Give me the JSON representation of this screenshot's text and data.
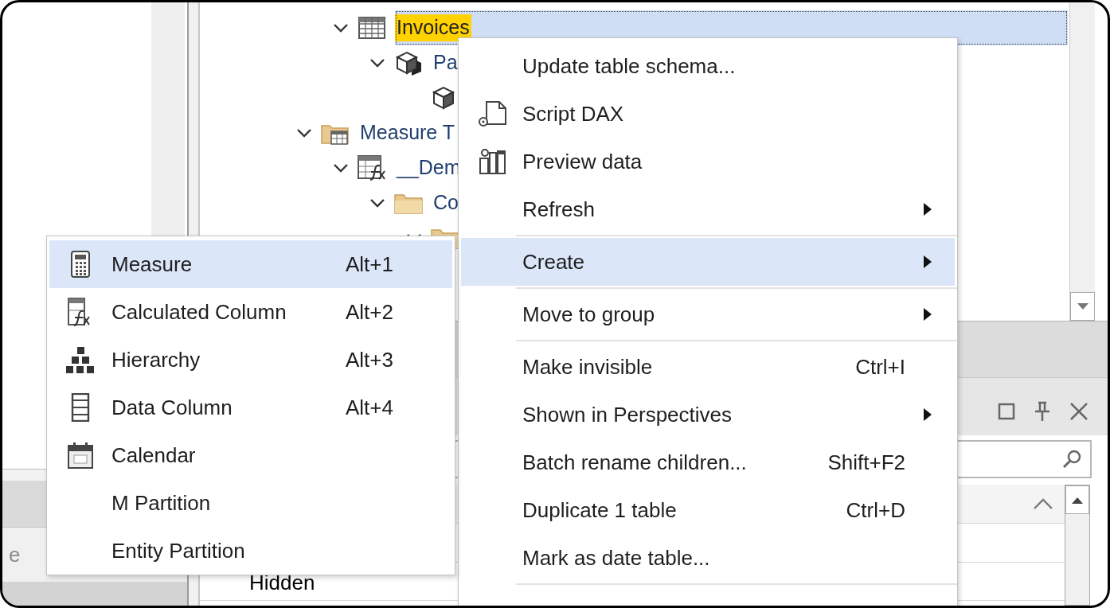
{
  "tree": {
    "items": [
      {
        "kind": "continued",
        "children": [
          {
            "kind": "table",
            "label": "Invoices",
            "expanded": true,
            "selected": true,
            "match": true,
            "children": [
              {
                "kind": "partitions",
                "label": "Pa",
                "expanded": true,
                "selected": false,
                "children": [
                  {
                    "kind": "partition",
                    "selected": false
                  }
                ]
              }
            ]
          }
        ]
      },
      {
        "kind": "measure-table",
        "label": "Measure T",
        "expanded": true,
        "selected": false,
        "children": [
          {
            "kind": "calc-table",
            "label": "__Dem",
            "expanded": true,
            "selected": false,
            "children": [
              {
                "kind": "folder",
                "label": "Co",
                "expanded": true,
                "selected": false,
                "children": [
                  {
                    "kind": "folder",
                    "expanded": true,
                    "selected": false
                  }
                ]
              }
            ]
          }
        ]
      }
    ]
  },
  "context_menu": {
    "items": [
      {
        "kind": "item",
        "label": "Update table schema...",
        "selected": false
      },
      {
        "kind": "item",
        "label": "Script DAX",
        "selected": false
      },
      {
        "kind": "item",
        "label": "Preview data",
        "selected": false
      },
      {
        "kind": "item",
        "label": "Refresh",
        "submenu": true,
        "selected": false
      },
      {
        "kind": "separator"
      },
      {
        "kind": "item",
        "label": "Create",
        "submenu": true,
        "selected": true
      },
      {
        "kind": "separator"
      },
      {
        "kind": "item",
        "label": "Move to group",
        "submenu": true,
        "selected": false
      },
      {
        "kind": "separator"
      },
      {
        "kind": "item",
        "label": "Make invisible",
        "shortcut": "Ctrl+I",
        "selected": false
      },
      {
        "kind": "item",
        "label": "Shown in Perspectives",
        "submenu": true,
        "selected": false
      },
      {
        "kind": "item",
        "label": "Batch rename children...",
        "shortcut": "Shift+F2",
        "selected": false
      },
      {
        "kind": "item",
        "label": "Duplicate 1 table",
        "shortcut": "Ctrl+D",
        "selected": false
      },
      {
        "kind": "item",
        "label": "Mark as date table...",
        "selected": false
      },
      {
        "kind": "separator"
      }
    ]
  },
  "create_submenu": {
    "items": [
      {
        "kind": "item",
        "label": "Measure",
        "shortcut": "Alt+1",
        "selected": true
      },
      {
        "kind": "item",
        "label": "Calculated Column",
        "shortcut": "Alt+2",
        "selected": false
      },
      {
        "kind": "item",
        "label": "Hierarchy",
        "shortcut": "Alt+3",
        "selected": false
      },
      {
        "kind": "item",
        "label": "Data Column",
        "shortcut": "Alt+4",
        "selected": false
      },
      {
        "kind": "item",
        "label": "Calendar",
        "selected": false
      },
      {
        "kind": "item",
        "label": "M Partition",
        "selected": false
      },
      {
        "kind": "item",
        "label": "Entity Partition",
        "selected": false
      }
    ]
  },
  "left_panel": {
    "row_text": "e"
  },
  "properties": {
    "rows": [
      {
        "value": "Hidden"
      }
    ]
  }
}
